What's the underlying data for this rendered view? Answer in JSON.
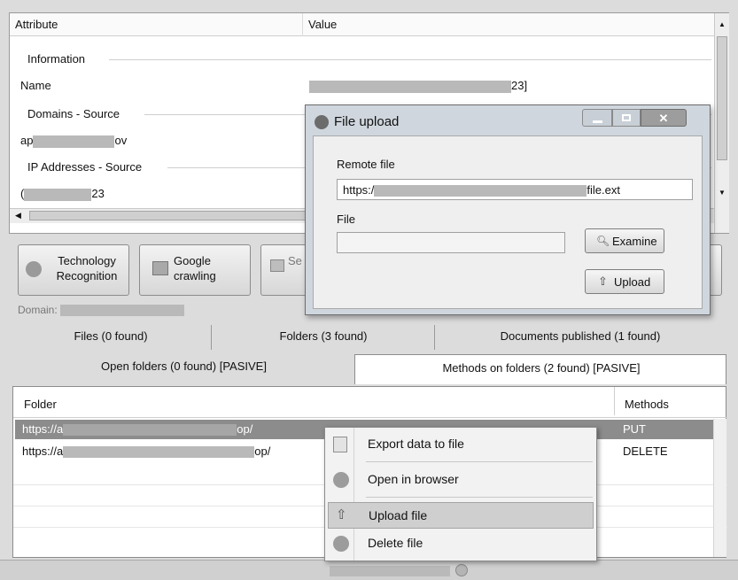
{
  "attributes": {
    "col_attribute": "Attribute",
    "col_value": "Value",
    "group_information": "Information",
    "name_label": "Name",
    "name_value_suffix": "23]",
    "group_domains": "Domains - Source",
    "domain_prefix": "ap",
    "domain_suffix": "ov",
    "group_ips": "IP Addresses - Source",
    "ip_prefix": "(",
    "ip_suffix": "23"
  },
  "toolbar": {
    "tech_line1": "Technology",
    "tech_line2": "Recognition",
    "google_line1": "Google",
    "google_line2": "crawling",
    "search_partial": "Se"
  },
  "domain_label": "Domain:",
  "tabs_row1": [
    "Files (0 found)",
    "Folders (3 found)",
    "Documents published (1 found)"
  ],
  "tabs_row2": [
    "Open folders (0 found) [PASIVE]",
    "Methods on folders (2 found) [PASIVE]"
  ],
  "folders": {
    "col_folder": "Folder",
    "col_methods": "Methods",
    "rows": [
      {
        "prefix": "https://a",
        "suffix": "op/",
        "method": "PUT"
      },
      {
        "prefix": "https://a",
        "suffix": "op/",
        "method": "DELETE"
      }
    ]
  },
  "dialog": {
    "title": "File upload",
    "remote_label": "Remote file",
    "remote_prefix": "https:/",
    "remote_suffix": "file.ext",
    "file_label": "File",
    "examine_label": "Examine",
    "upload_label": "Upload"
  },
  "context_menu": {
    "items": [
      "Export  data to file",
      "Open in browser",
      "Upload file",
      "Delete file"
    ]
  }
}
